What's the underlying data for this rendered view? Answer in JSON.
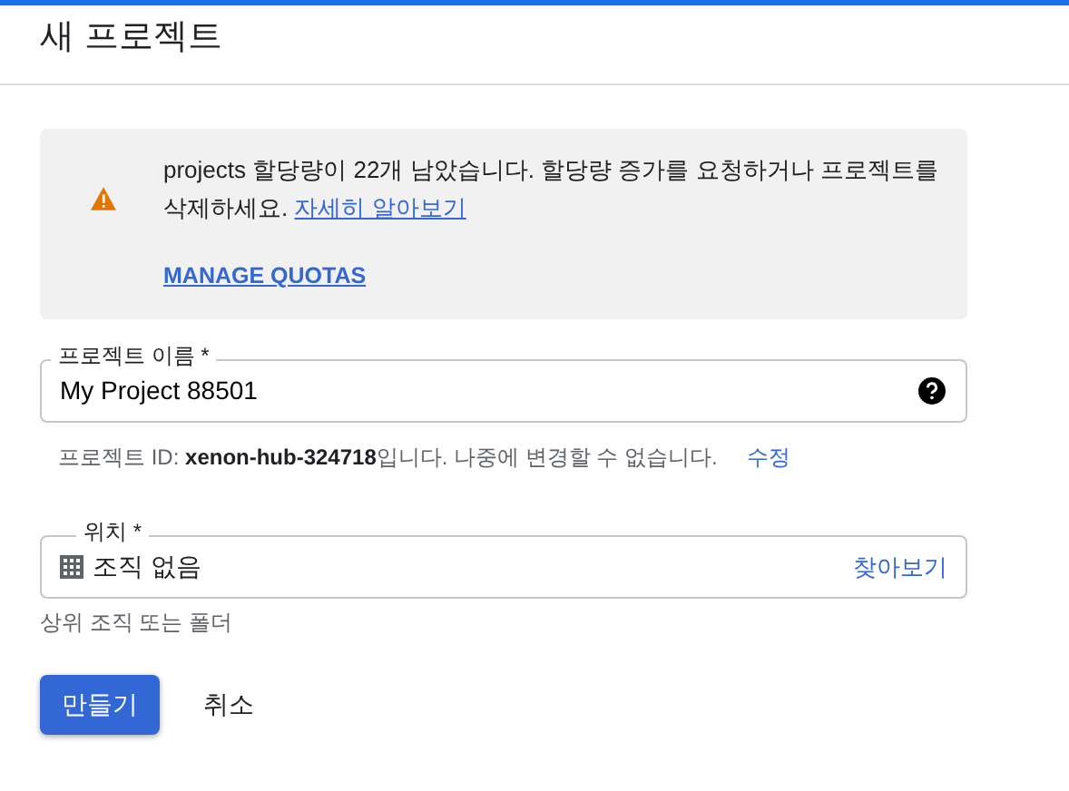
{
  "title": "새 프로젝트",
  "alert": {
    "message": "projects 할당량이 22개 남았습니다. 할당량 증가를 요청하거나 프로젝트를 삭제하세요.",
    "link": "자세히 알아보기",
    "action": "MANAGE QUOTAS"
  },
  "name_field": {
    "label": "프로젝트 이름 *",
    "value": "My Project 88501"
  },
  "project_id_note": "프로젝트 ID: **xenon-hub-324718**입니다. 나중에 변경할 수 없습니다.",
  "edit_link": "수정",
  "location_field": {
    "label": "위치 *",
    "value": "조직 없음",
    "browse": "찾아보기",
    "hint": "상위 조직 또는 폴더"
  },
  "buttons": [
    {
      "label": "만들기",
      "kind": "primary"
    },
    {
      "label": "취소",
      "kind": "text"
    }
  ]
}
